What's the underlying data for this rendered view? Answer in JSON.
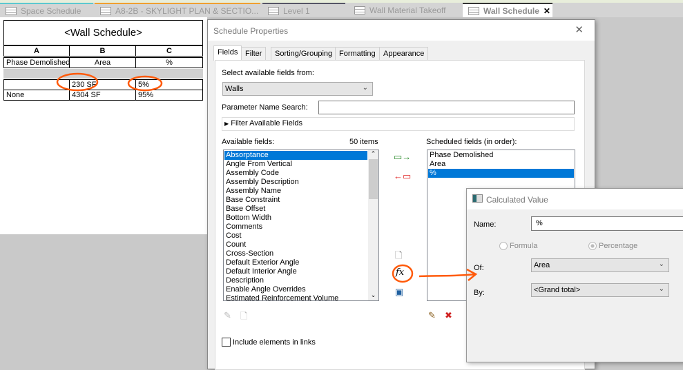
{
  "tabs": [
    {
      "label": "Space Schedule"
    },
    {
      "label": "A8-2B - SKYLIGHT PLAN & SECTIO..."
    },
    {
      "label": "Level 1"
    },
    {
      "label": "Wall Material Takeoff"
    },
    {
      "label": "Wall Schedule",
      "close": "✕"
    }
  ],
  "schedule": {
    "title": "<Wall Schedule>",
    "columns": [
      "A",
      "B",
      "C"
    ],
    "headers": [
      "Phase Demolished",
      "Area",
      "%"
    ],
    "rows": [
      [
        "",
        "230 SF",
        "5%"
      ],
      [
        "None",
        "4304 SF",
        "95%"
      ]
    ]
  },
  "props": {
    "title": "Schedule Properties",
    "close": "✕",
    "tabs": [
      "Fields",
      "Filter",
      "Sorting/Grouping",
      "Formatting",
      "Appearance"
    ],
    "select_label": "Select available fields from:",
    "select_value": "Walls",
    "param_label": "Parameter Name Search:",
    "param_value": "",
    "filter_label": "Filter Available Fields",
    "available_label": "Available fields:",
    "count": "50 items",
    "available": [
      "Absorptance",
      "Angle From Vertical",
      "Assembly Code",
      "Assembly Description",
      "Assembly Name",
      "Base Constraint",
      "Base Offset",
      "Bottom Width",
      "Comments",
      "Cost",
      "Count",
      "Cross-Section",
      "Default Exterior Angle",
      "Default Interior Angle",
      "Description",
      "Enable Angle Overrides",
      "Estimated Reinforcement Volume"
    ],
    "scheduled_label": "Scheduled fields (in order):",
    "scheduled": [
      "Phase Demolished",
      "Area",
      "%"
    ],
    "include_links": "Include elements in links",
    "fx": "fx"
  },
  "calc": {
    "title": "Calculated Value",
    "name_label": "Name:",
    "name_value": "%",
    "formula": "Formula",
    "percentage": "Percentage",
    "of_label": "Of:",
    "of_value": "Area",
    "by_label": "By:",
    "by_value": "<Grand total>"
  },
  "colors": {
    "annotation": "#ff5a0a",
    "selection": "#0078d7"
  }
}
